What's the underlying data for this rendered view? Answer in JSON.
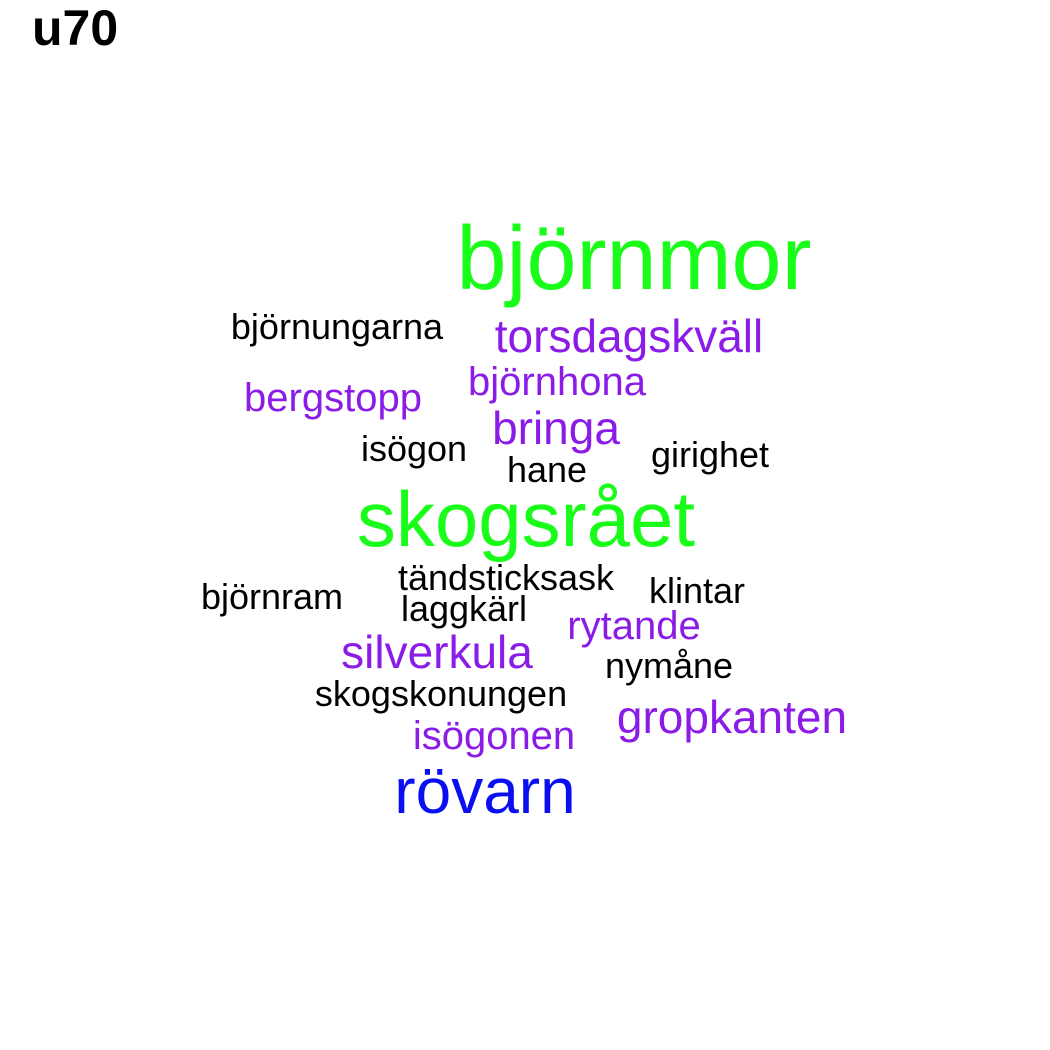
{
  "title": "u70",
  "colors": {
    "green": "#1afd1a",
    "purple": "#8b1ce8",
    "blue": "#0a0ff2",
    "black": "#000000"
  },
  "words": [
    {
      "key": "bjornmor",
      "text": "björnmor",
      "color": "#1afd1a"
    },
    {
      "key": "skogsraet",
      "text": "skogsrået",
      "color": "#1afd1a"
    },
    {
      "key": "rovarn",
      "text": "rövarn",
      "color": "#0a0ff2"
    },
    {
      "key": "torsdagskvall",
      "text": "torsdagskväll",
      "color": "#8b1ce8"
    },
    {
      "key": "bjornhona",
      "text": "björnhona",
      "color": "#8b1ce8"
    },
    {
      "key": "bergstopp",
      "text": "bergstopp",
      "color": "#8b1ce8"
    },
    {
      "key": "bringa",
      "text": "bringa",
      "color": "#8b1ce8"
    },
    {
      "key": "silverkula",
      "text": "silverkula",
      "color": "#8b1ce8"
    },
    {
      "key": "rytande",
      "text": "rytande",
      "color": "#8b1ce8"
    },
    {
      "key": "gropkanten",
      "text": "gropkanten",
      "color": "#8b1ce8"
    },
    {
      "key": "isogonen",
      "text": "isögonen",
      "color": "#8b1ce8"
    },
    {
      "key": "bjornungarna",
      "text": "björnungarna",
      "color": "#000000"
    },
    {
      "key": "isogon",
      "text": "isögon",
      "color": "#000000"
    },
    {
      "key": "hane",
      "text": "hane",
      "color": "#000000"
    },
    {
      "key": "girighet",
      "text": "girighet",
      "color": "#000000"
    },
    {
      "key": "tandsticksask",
      "text": "tändsticksask",
      "color": "#000000"
    },
    {
      "key": "klintar",
      "text": "klintar",
      "color": "#000000"
    },
    {
      "key": "bjornram",
      "text": "björnram",
      "color": "#000000"
    },
    {
      "key": "laggkarl",
      "text": "laggkärl",
      "color": "#000000"
    },
    {
      "key": "nymane",
      "text": "nymåne",
      "color": "#000000"
    },
    {
      "key": "skogskonungen",
      "text": "skogskonungen",
      "color": "#000000"
    }
  ]
}
